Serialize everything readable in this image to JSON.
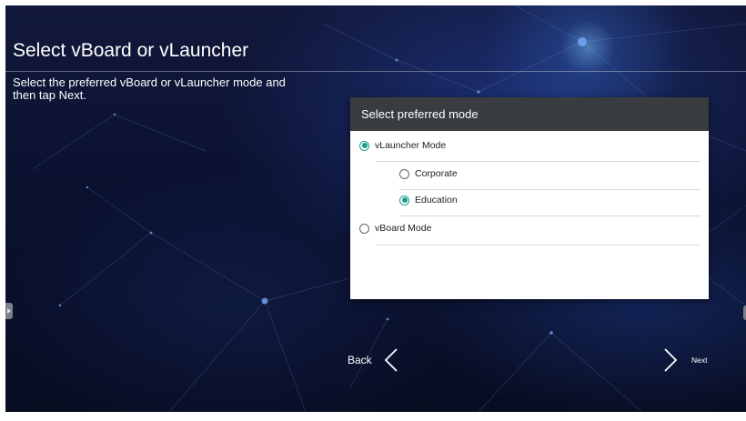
{
  "page": {
    "title": "Select vBoard or vLauncher",
    "instruction": "Select the preferred vBoard or vLauncher mode and then tap Next."
  },
  "dialog": {
    "title": "Select preferred mode",
    "options": [
      {
        "label": "vLauncher Mode",
        "selected": true
      },
      {
        "label": "Corporate",
        "selected": false
      },
      {
        "label": "Education",
        "selected": true
      },
      {
        "label": "vBoard Mode",
        "selected": false
      }
    ]
  },
  "nav": {
    "back_label": "Back",
    "next_label": "Next"
  },
  "colors": {
    "accent": "#1e9e8c",
    "dialog_header": "#3a3d40",
    "background": "#0b1230"
  },
  "icons": {
    "back": "chevron-left-icon",
    "next": "chevron-right-icon",
    "side_handle": "caret-right-icon"
  }
}
